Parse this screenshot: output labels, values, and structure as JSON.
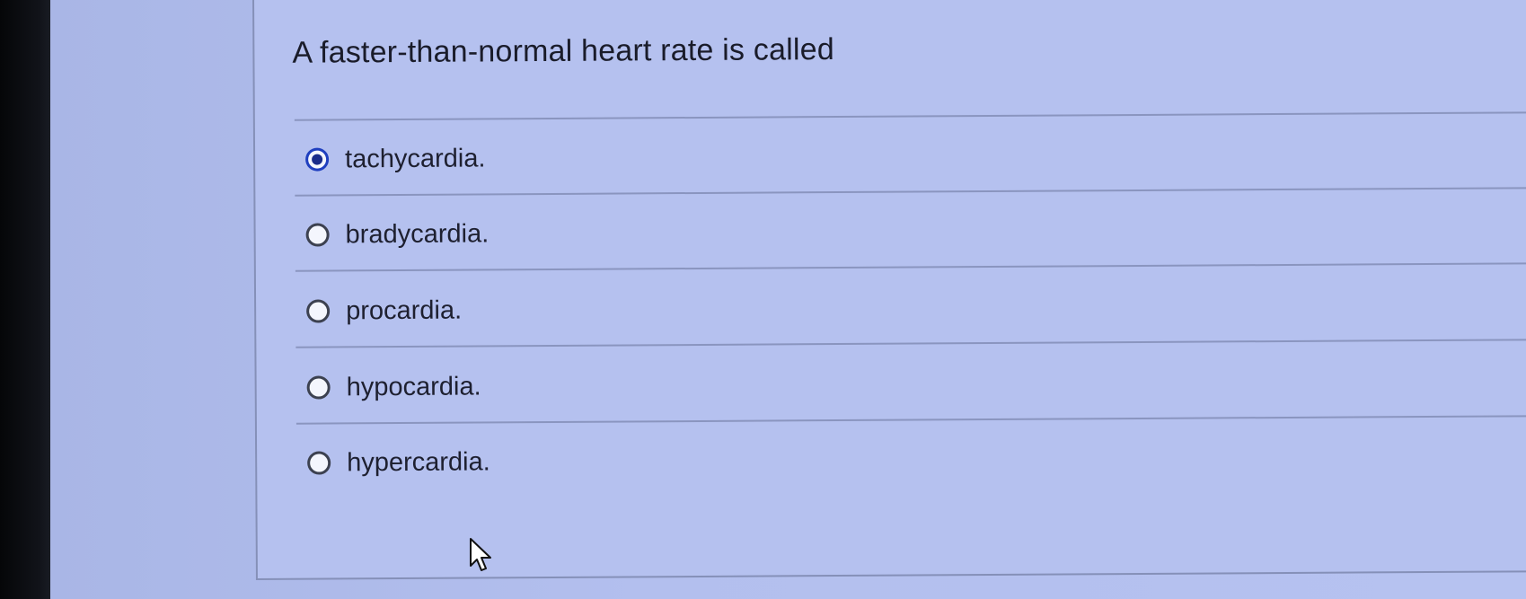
{
  "question": {
    "text": "A faster-than-normal heart rate is called"
  },
  "options": [
    {
      "label": "tachycardia.",
      "selected": true
    },
    {
      "label": "bradycardia.",
      "selected": false
    },
    {
      "label": "procardia.",
      "selected": false
    },
    {
      "label": "hypocardia.",
      "selected": false
    },
    {
      "label": "hypercardia.",
      "selected": false
    }
  ],
  "icons": {
    "cursor": "mouse-pointer-icon",
    "radio_selected": "radio-selected-icon",
    "radio_unselected": "radio-unselected-icon"
  },
  "colors": {
    "background": "#b5c1ef",
    "selected_radio": "#1a2c8a",
    "text": "#1e2030"
  }
}
